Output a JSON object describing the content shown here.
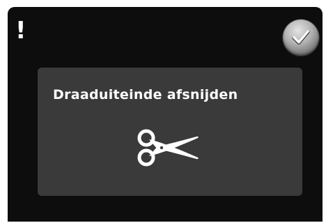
{
  "alert": {
    "icon": "exclamation-icon",
    "symbol": "!"
  },
  "confirm_button": {
    "icon": "checkmark-icon"
  },
  "dialog": {
    "message": "Draaduiteinde afsnijden",
    "icon": "scissors-icon"
  },
  "colors": {
    "panel_background": "#0d0d0d",
    "dialog_background": "#3a3a3a",
    "text": "#ffffff",
    "confirm_button": "#9a9a9a"
  }
}
